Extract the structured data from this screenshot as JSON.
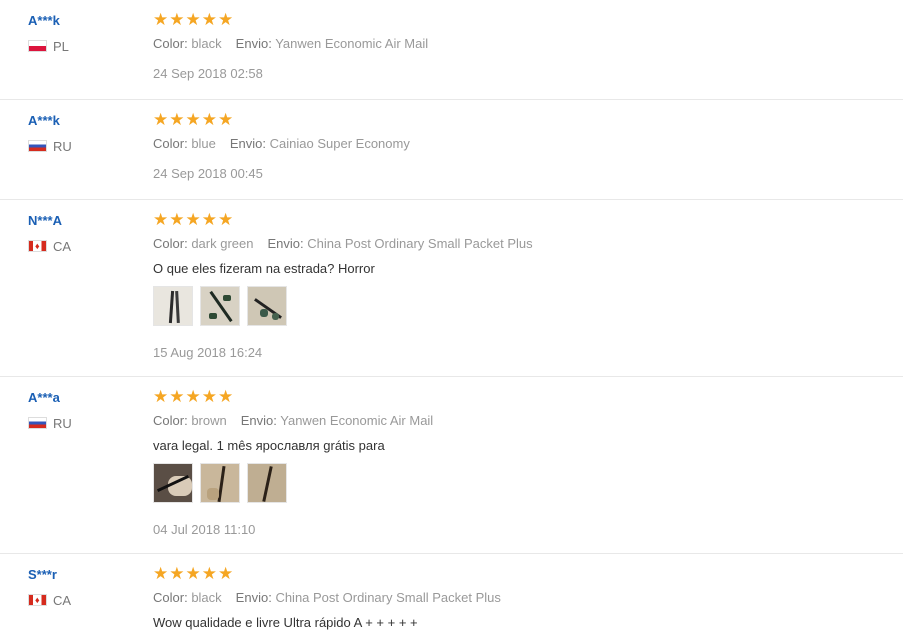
{
  "reviews": [
    {
      "user": "A***k",
      "country": "PL",
      "flag": "pl",
      "stars": "★★★★★",
      "rating": 5,
      "color_label": "Color:",
      "color_value": "black",
      "ship_label": "Envio:",
      "ship_value": "Yanwen Economic Air Mail",
      "comment": "",
      "date": "24 Sep 2018 02:58"
    },
    {
      "user": "A***k",
      "country": "RU",
      "flag": "ru",
      "stars": "★★★★★",
      "rating": 5,
      "color_label": "Color:",
      "color_value": "blue",
      "ship_label": "Envio:",
      "ship_value": "Cainiao Super Economy",
      "comment": "",
      "date": "24 Sep 2018 00:45"
    },
    {
      "user": "N***A",
      "country": "CA",
      "flag": "ca",
      "stars": "★★★★★",
      "rating": 5,
      "color_label": "Color:",
      "color_value": "dark green",
      "ship_label": "Envio:",
      "ship_value": "China Post Ordinary Small Packet Plus",
      "comment": "O que eles fizeram na estrada? Horror",
      "date": "15 Aug 2018 16:24"
    },
    {
      "user": "A***a",
      "country": "RU",
      "flag": "ru",
      "stars": "★★★★★",
      "rating": 5,
      "color_label": "Color:",
      "color_value": "brown",
      "ship_label": "Envio:",
      "ship_value": "Yanwen Economic Air Mail",
      "comment": "vara legal. 1 mês ярославля grátis para",
      "date": "04 Jul 2018 11:10"
    },
    {
      "user": "S***r",
      "country": "CA",
      "flag": "ca",
      "stars": "★★★★★",
      "rating": 5,
      "color_label": "Color:",
      "color_value": "black",
      "ship_label": "Envio:",
      "ship_value": "China Post Ordinary Small Packet Plus",
      "comment": "Wow qualidade e livre Ultra rápido A + + + + +",
      "date": ""
    }
  ]
}
